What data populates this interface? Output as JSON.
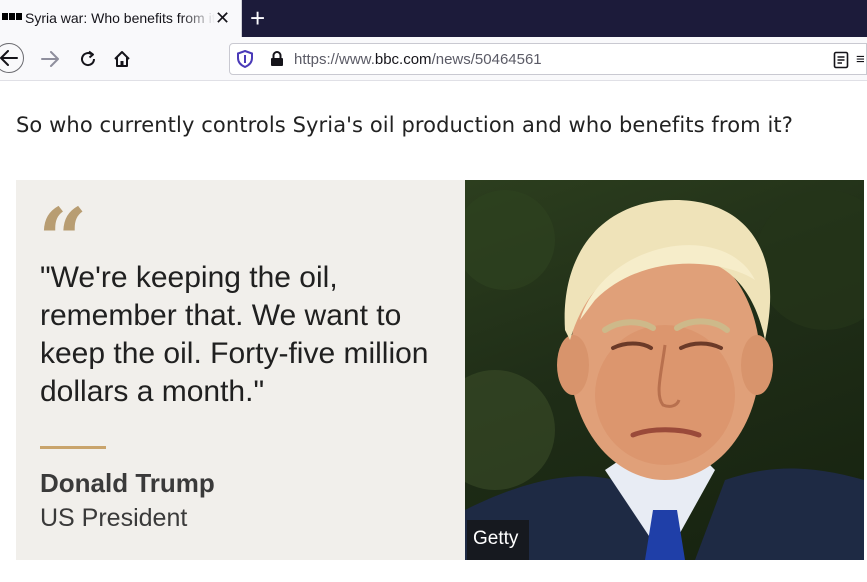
{
  "browser": {
    "tab": {
      "title": "Syria war: Who benefits from it",
      "close_glyph": "✕"
    },
    "new_tab_glyph": "+",
    "nav": {
      "back_icon": "arrow-left-icon",
      "forward_icon": "arrow-right-icon",
      "reload_icon": "reload-icon",
      "home_icon": "home-icon"
    },
    "url": {
      "prefix": "https://www.",
      "domain": "bbc.com",
      "path": "/news/50464561"
    },
    "overflow_glyph": "≡"
  },
  "article": {
    "question": "So who currently controls Syria's oil production and who benefits from it?",
    "quote": {
      "mark": "“",
      "text": "\"We're keeping the oil, remember that. We want to keep the oil. Forty-five million dollars a month.\"",
      "author": "Donald Trump",
      "role": "US President",
      "accent_color": "#c9a46c"
    },
    "photo": {
      "credit": "Getty"
    }
  }
}
